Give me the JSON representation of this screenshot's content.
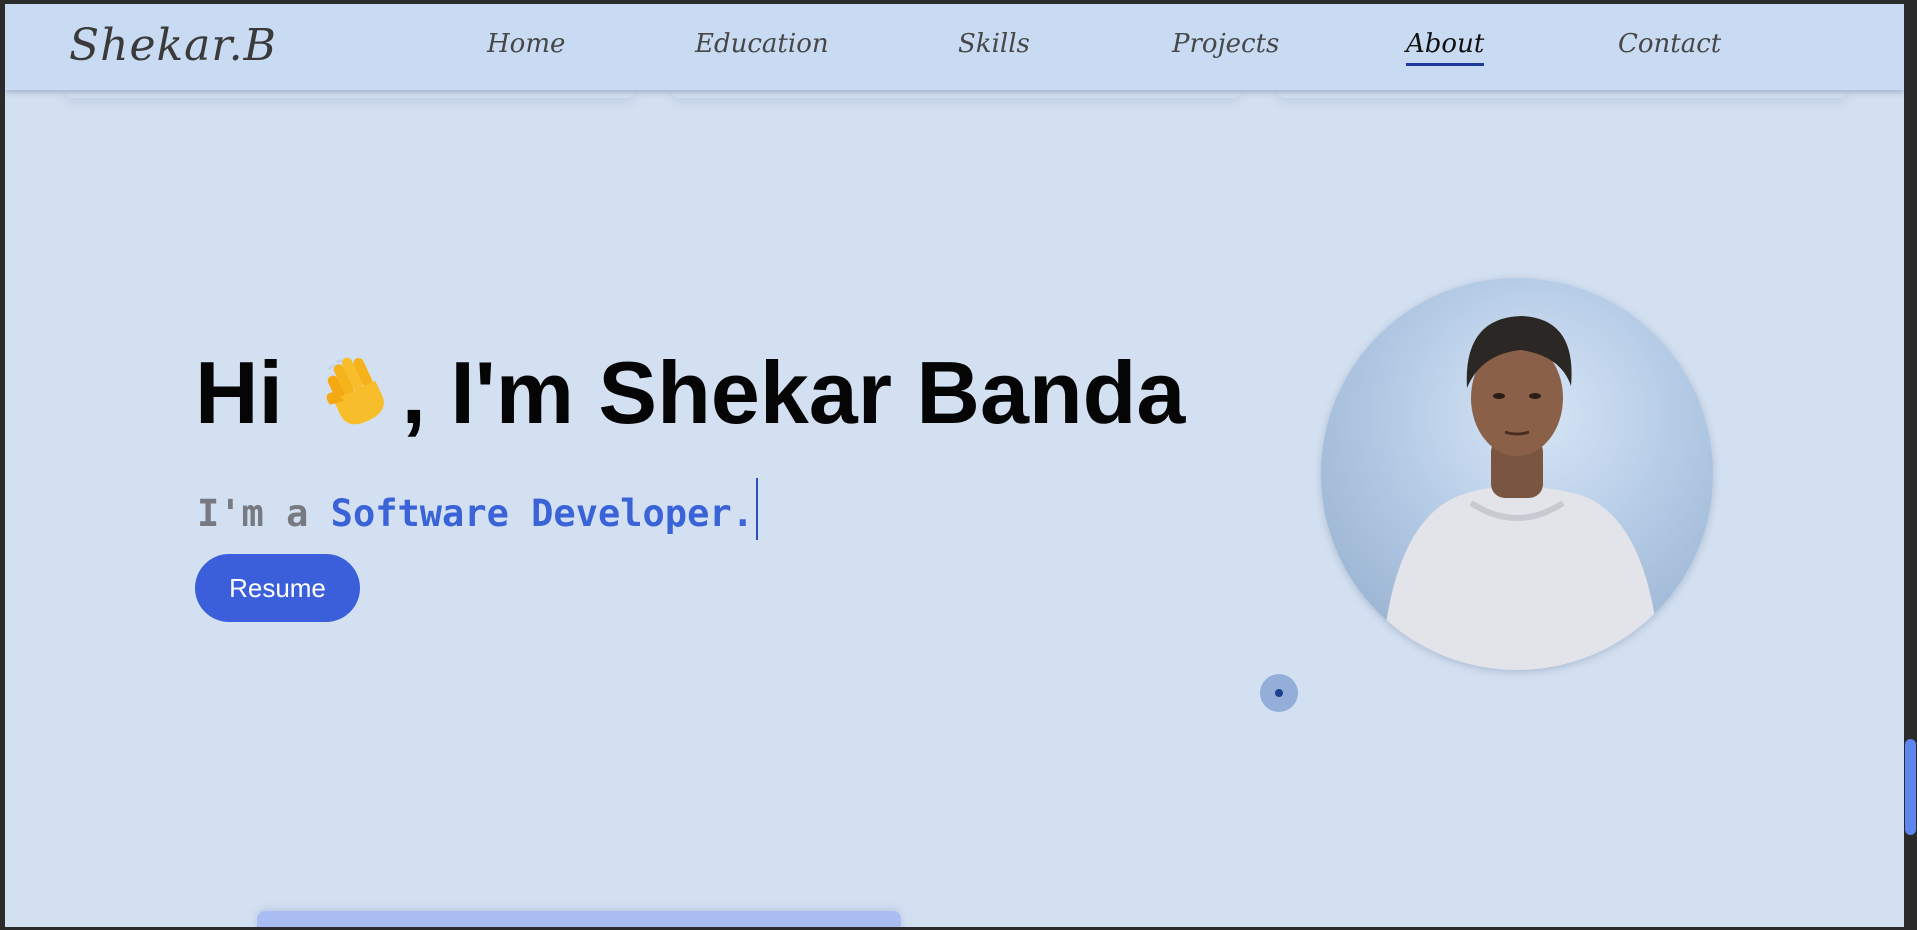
{
  "header": {
    "brand": "Shekar.B",
    "nav": [
      {
        "label": "Home",
        "active": false
      },
      {
        "label": "Education",
        "active": false
      },
      {
        "label": "Skills",
        "active": false
      },
      {
        "label": "Projects",
        "active": false
      },
      {
        "label": "About",
        "active": true
      },
      {
        "label": "Contact",
        "active": false
      }
    ]
  },
  "hero": {
    "greeting_hi": "Hi",
    "greeting_rest": ", I'm Shekar Banda",
    "emoji_icon": "waving-hand-icon",
    "subtitle_prefix": "I'm a",
    "subtitle_role": "Software Developer.",
    "resume_label": "Resume"
  },
  "profile": {
    "avatar_icon": "profile-photo"
  },
  "colors": {
    "page_bg": "#d3e0f1",
    "nav_bg": "#c8dbf2",
    "accent": "#3b5fdb",
    "active_underline": "#1e3a9e",
    "role_text": "#3b63d8"
  }
}
